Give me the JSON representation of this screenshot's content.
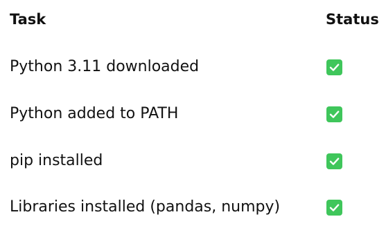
{
  "table": {
    "headers": {
      "task": "Task",
      "status": "Status"
    },
    "rows": [
      {
        "task": "Python 3.11 downloaded",
        "status_icon": "checkmark-icon",
        "status_color": "#3fc65b"
      },
      {
        "task": "Python added to PATH",
        "status_icon": "checkmark-icon",
        "status_color": "#3fc65b"
      },
      {
        "task": "pip installed",
        "status_icon": "checkmark-icon",
        "status_color": "#3fc65b"
      },
      {
        "task": "Libraries installed (pandas, numpy)",
        "status_icon": "checkmark-icon",
        "status_color": "#3fc65b"
      }
    ]
  }
}
